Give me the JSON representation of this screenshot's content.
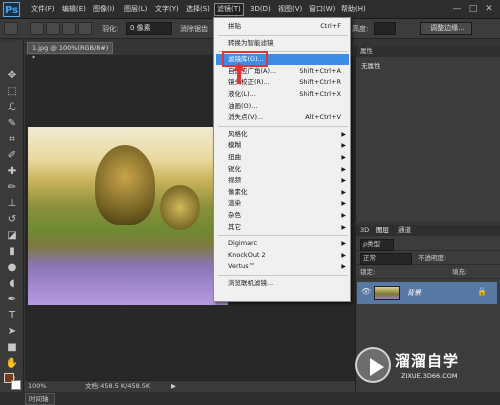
{
  "app": {
    "logo": "Ps"
  },
  "menubar": {
    "items": [
      "文件(F)",
      "编辑(E)",
      "图像(I)",
      "图层(L)",
      "文字(Y)",
      "选择(S)",
      "滤镜(T)",
      "3D(D)",
      "视图(V)",
      "窗口(W)",
      "帮助(H)"
    ],
    "active": "滤镜(T)",
    "window_buttons": [
      "—",
      "□",
      "✕"
    ]
  },
  "options": {
    "feather_label": "羽化:",
    "feather_value": "0 像素",
    "antialias_label": "消除锯齿",
    "height_label": "高度:",
    "refine_edge_button": "调整边缘..."
  },
  "document": {
    "tab_title": "1.jpg @ 100%(RGB/8#) *",
    "zoom": "100%",
    "doc_info": "文档:458.5 K/458.5K"
  },
  "filter_menu": {
    "items": [
      {
        "label": "拼贴",
        "shortcut": "Ctrl+F"
      },
      {
        "sep": true
      },
      {
        "label": "转换为智能滤镜"
      },
      {
        "sep": true
      },
      {
        "label": "滤镜库(G)...",
        "highlight": true
      },
      {
        "label": "自适应广角(A)...",
        "shortcut": "Shift+Ctrl+A"
      },
      {
        "label": "镜头校正(R)...",
        "shortcut": "Shift+Ctrl+R"
      },
      {
        "label": "液化(L)...",
        "shortcut": "Shift+Ctrl+X"
      },
      {
        "label": "油画(O)..."
      },
      {
        "label": "消失点(V)...",
        "shortcut": "Alt+Ctrl+V"
      },
      {
        "sep": true
      },
      {
        "label": "风格化",
        "submenu": true
      },
      {
        "label": "模糊",
        "submenu": true
      },
      {
        "label": "扭曲",
        "submenu": true
      },
      {
        "label": "锐化",
        "submenu": true
      },
      {
        "label": "视频",
        "submenu": true
      },
      {
        "label": "像素化",
        "submenu": true
      },
      {
        "label": "渲染",
        "submenu": true
      },
      {
        "label": "杂色",
        "submenu": true
      },
      {
        "label": "其它",
        "submenu": true
      },
      {
        "sep": true
      },
      {
        "label": "Digimarc",
        "submenu": true
      },
      {
        "label": "KnockOut 2",
        "submenu": true
      },
      {
        "label": "Vertus™",
        "submenu": true
      },
      {
        "sep": true
      },
      {
        "label": "浏览联机滤镜..."
      }
    ]
  },
  "properties_panel": {
    "tab": "属性",
    "content": "无属性"
  },
  "layers_panel": {
    "tabs": [
      "3D",
      "图层",
      "通道"
    ],
    "kind_label": "ρ类型",
    "blend_mode": "正常",
    "opacity_label": "不透明度:",
    "lock_label": "锁定:",
    "fill_label": "填充:",
    "layer_name": "背景"
  },
  "timeline": {
    "tab": "时间轴"
  },
  "watermark": {
    "title": "溜溜自学",
    "subtitle": "ZIXUE.3D66.COM"
  },
  "colors": {
    "accent": "#3d8ce6",
    "highlight_box": "#e23434",
    "foreground": "#7a3a1a",
    "background": "#ffffff"
  }
}
